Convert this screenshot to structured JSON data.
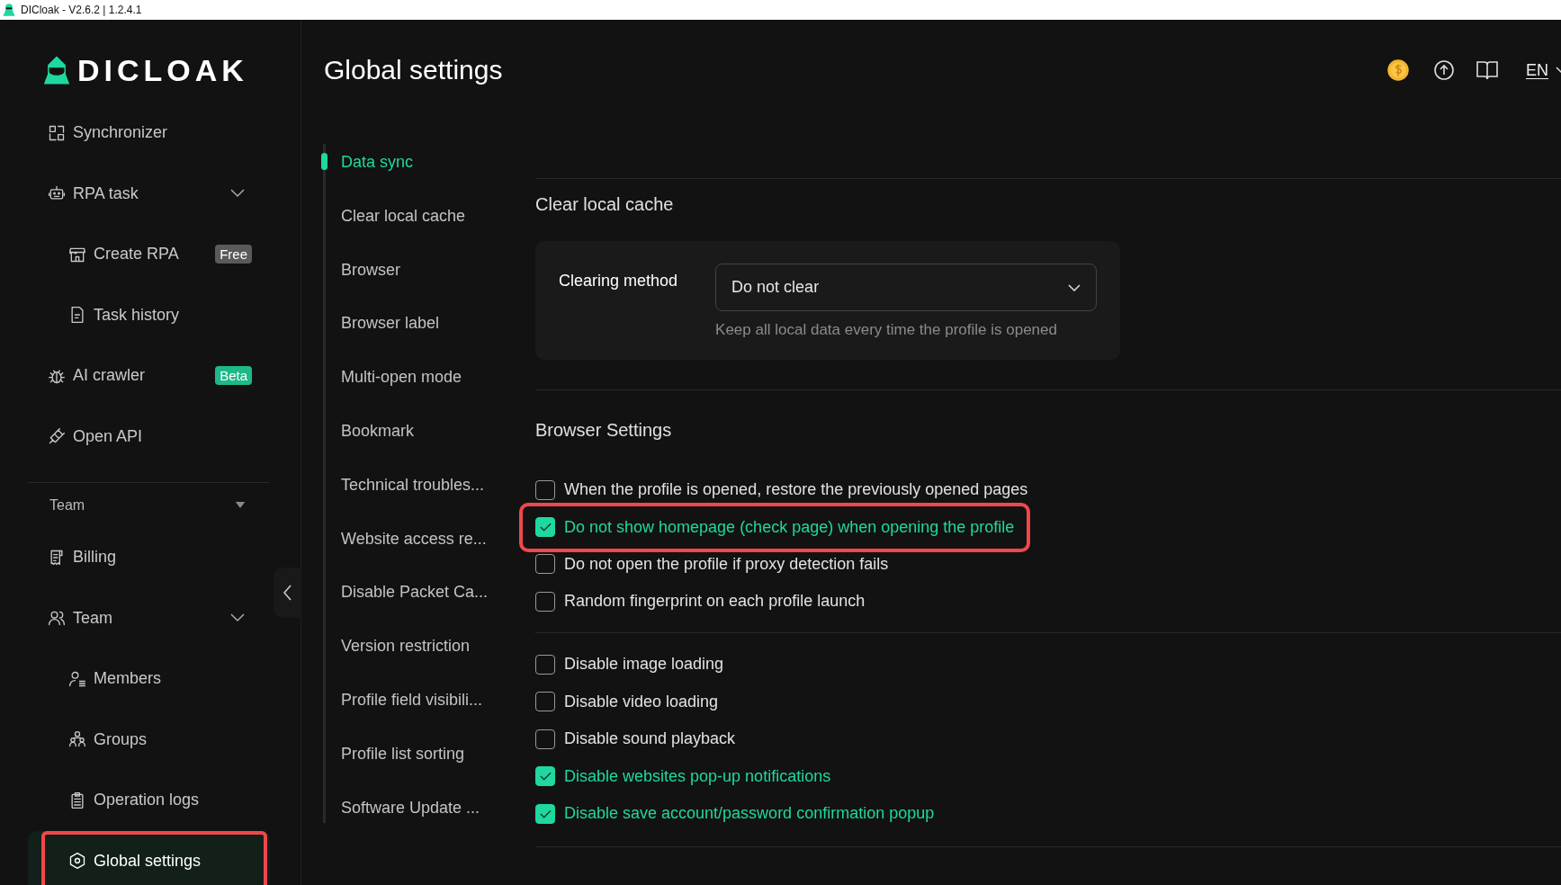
{
  "window": {
    "title": "DICloak - V2.6.2 | 1.2.4.1"
  },
  "logo": {
    "text": "DICLOAK"
  },
  "sidebar": {
    "items": [
      {
        "kind": "item",
        "label": "Synchronizer",
        "selected": false,
        "highlighted": false
      },
      {
        "kind": "item",
        "label": "RPA task",
        "selected": false,
        "highlighted": false,
        "expanded": true,
        "children": [
          {
            "label": "Create RPA",
            "selected": false,
            "highlighted": false,
            "badge": {
              "text": "Free",
              "color": "#5a5a5a"
            }
          },
          {
            "label": "Task history",
            "selected": false,
            "highlighted": false
          }
        ]
      },
      {
        "kind": "item",
        "label": "AI crawler",
        "selected": false,
        "highlighted": false,
        "badge": {
          "text": "Beta",
          "color": "#1fb889"
        }
      },
      {
        "kind": "item",
        "label": "Open API",
        "selected": false,
        "highlighted": false
      },
      {
        "kind": "section",
        "label": "Team"
      },
      {
        "kind": "item",
        "label": "Billing",
        "selected": false,
        "highlighted": false
      },
      {
        "kind": "item",
        "label": "Team",
        "selected": false,
        "highlighted": false,
        "expanded": true,
        "children": [
          {
            "label": "Members",
            "selected": false,
            "highlighted": false
          },
          {
            "label": "Groups",
            "selected": false,
            "highlighted": false
          },
          {
            "label": "Operation logs",
            "selected": false,
            "highlighted": false
          },
          {
            "label": "Global settings",
            "selected": true,
            "highlighted": true
          }
        ]
      }
    ]
  },
  "header": {
    "title": "Global settings",
    "language": "EN"
  },
  "settings_nav": [
    {
      "label": "Data sync",
      "selected": true
    },
    {
      "label": "Clear local cache",
      "selected": false
    },
    {
      "label": "Browser",
      "selected": false
    },
    {
      "label": "Browser label",
      "selected": false
    },
    {
      "label": "Multi-open mode",
      "selected": false
    },
    {
      "label": "Bookmark",
      "selected": false
    },
    {
      "label": "Technical troubles...",
      "selected": false
    },
    {
      "label": "Website access re...",
      "selected": false
    },
    {
      "label": "Disable Packet Ca...",
      "selected": false
    },
    {
      "label": "Version restriction",
      "selected": false
    },
    {
      "label": "Profile field visibili...",
      "selected": false
    },
    {
      "label": "Profile list sorting",
      "selected": false
    },
    {
      "label": "Software Update ...",
      "selected": false
    }
  ],
  "clear_cache": {
    "heading": "Clear local cache",
    "field_label": "Clearing method",
    "value": "Do not clear",
    "hint": "Keep all local data every time the profile is opened"
  },
  "browser_settings": {
    "heading": "Browser Settings",
    "groups": [
      [
        {
          "label": "When the profile is opened, restore the previously opened pages",
          "checked": false,
          "highlighted": false
        },
        {
          "label": "Do not show homepage (check page) when opening the profile",
          "checked": true,
          "highlighted": true
        },
        {
          "label": "Do not open the profile if proxy detection fails",
          "checked": false,
          "highlighted": false
        },
        {
          "label": "Random fingerprint on each profile launch",
          "checked": false,
          "highlighted": false
        }
      ],
      [
        {
          "label": "Disable image loading",
          "checked": false,
          "highlighted": false
        },
        {
          "label": "Disable video loading",
          "checked": false,
          "highlighted": false
        },
        {
          "label": "Disable sound playback",
          "checked": false,
          "highlighted": false
        },
        {
          "label": "Disable websites pop-up notifications",
          "checked": true,
          "highlighted": false
        },
        {
          "label": "Disable save account/password confirmation popup",
          "checked": true,
          "highlighted": false
        }
      ]
    ]
  }
}
